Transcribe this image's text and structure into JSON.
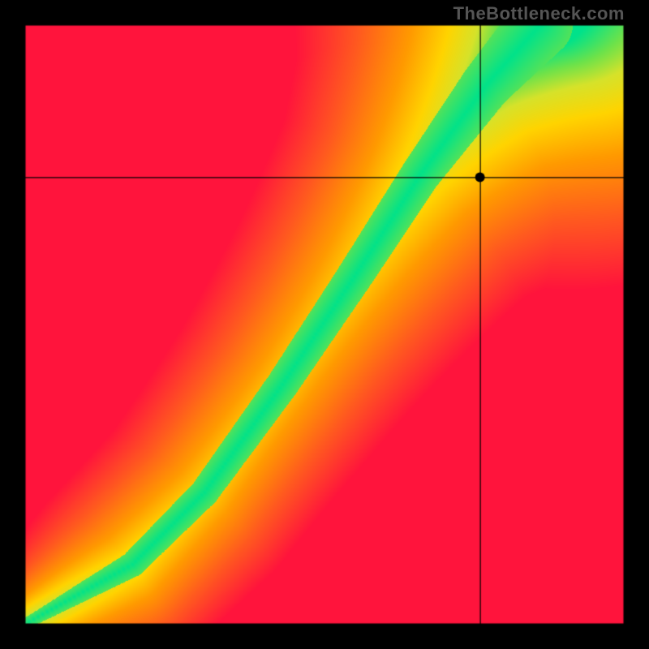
{
  "watermark": "TheBottleneck.com",
  "chart_data": {
    "type": "heatmap",
    "title": "",
    "xlabel": "",
    "ylabel": "",
    "xlim": [
      0,
      1
    ],
    "ylim": [
      0,
      1
    ],
    "marker": {
      "x": 0.76,
      "y": 0.745
    },
    "crosshair": {
      "x": 0.76,
      "y": 0.745
    },
    "curve_control_points": [
      {
        "t": 0.0,
        "x": 0.0,
        "y": 0.0,
        "half_width": 0.015
      },
      {
        "t": 0.12,
        "x": 0.18,
        "y": 0.1,
        "half_width": 0.035
      },
      {
        "t": 0.25,
        "x": 0.3,
        "y": 0.22,
        "half_width": 0.04
      },
      {
        "t": 0.4,
        "x": 0.43,
        "y": 0.4,
        "half_width": 0.045
      },
      {
        "t": 0.55,
        "x": 0.55,
        "y": 0.58,
        "half_width": 0.05
      },
      {
        "t": 0.7,
        "x": 0.66,
        "y": 0.75,
        "half_width": 0.055
      },
      {
        "t": 0.85,
        "x": 0.77,
        "y": 0.9,
        "half_width": 0.07
      },
      {
        "t": 1.0,
        "x": 0.86,
        "y": 1.0,
        "half_width": 0.09
      }
    ],
    "color_stops": [
      {
        "d": 0.0,
        "color": "#00e28a"
      },
      {
        "d": 0.08,
        "color": "#6de24a"
      },
      {
        "d": 0.16,
        "color": "#d6e22a"
      },
      {
        "d": 0.28,
        "color": "#ffd400"
      },
      {
        "d": 0.45,
        "color": "#ff9a00"
      },
      {
        "d": 0.7,
        "color": "#ff5a1f"
      },
      {
        "d": 1.0,
        "color": "#ff143c"
      }
    ],
    "corner_bias": {
      "top_left_red": 1.0,
      "bottom_right_red": 1.0,
      "top_right_yellow": 0.55,
      "bottom_left_orange": 0.35
    }
  }
}
